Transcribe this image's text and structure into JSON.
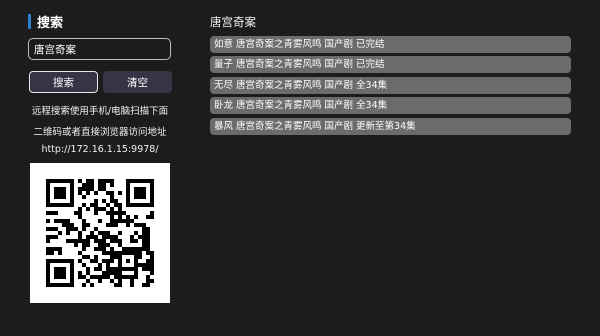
{
  "search_panel": {
    "title": "搜索",
    "input_value": "唐宫奇案",
    "search_button": "搜索",
    "clear_button": "清空",
    "hint_lines": [
      "远程搜索使用手机/电脑扫描下面",
      "二维码或者直接浏览器访问地址",
      "http://172.16.1.15:9978/"
    ]
  },
  "results": {
    "title": "唐宫奇案",
    "items": [
      {
        "label": "如意 唐宫奇案之青雾风鸣 国产剧 已完结"
      },
      {
        "label": "量子 唐宫奇案之青雾风鸣 国产剧 已完结"
      },
      {
        "label": "无尽 唐宫奇案之青雾风鸣 国产剧 全34集"
      },
      {
        "label": "卧龙 唐宫奇案之青雾风鸣 国产剧 全34集"
      },
      {
        "label": "暴风 唐宫奇案之青雾风鸣 国产剧 更新至第34集"
      }
    ]
  },
  "qr_code": {
    "icon": "qr-code-icon"
  },
  "colors": {
    "background": "#1c1c1c",
    "accent": "#2d7fd0",
    "button": "#353546",
    "result_item": "#6b6b6b"
  }
}
